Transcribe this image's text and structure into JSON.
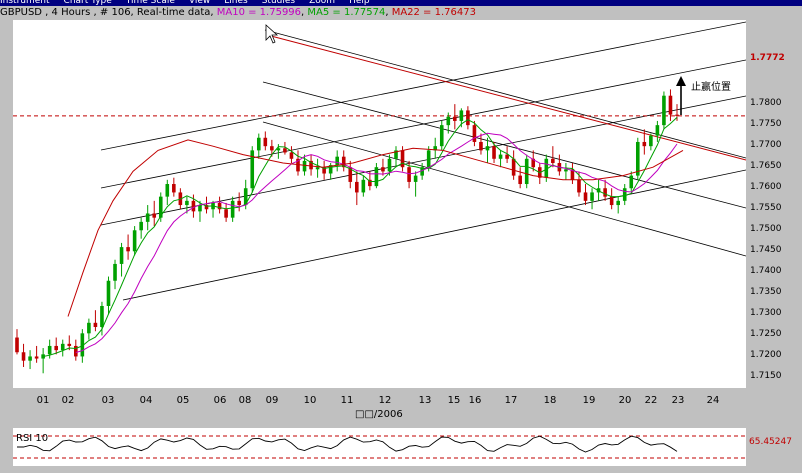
{
  "menu": [
    "Instrument",
    "Chart Type",
    "Time Scale",
    "View",
    "Lines",
    "Studies",
    "Zoom",
    "Help"
  ],
  "header": {
    "title": "GBPUSD , 4 Hours , # 106, Real-time data",
    "ma10": "MA10 = 1.75996",
    "ma5": "MA5 = 1.77574",
    "ma22": "MA22 = 1.76473"
  },
  "colors": {
    "up": "#00a000",
    "down": "#c00000",
    "ma5": "#00a000",
    "ma10": "#c000c0",
    "ma22": "#c00000",
    "ref": "#c00000"
  },
  "chart_data": {
    "type": "candlestick",
    "xlabel": "□□/2006",
    "ylim": [
      1.7125,
      1.8
    ],
    "yticks": [
      "1.7150",
      "1.7200",
      "1.7250",
      "1.7300",
      "1.7350",
      "1.7400",
      "1.7450",
      "1.7500",
      "1.7550",
      "1.7600",
      "1.7650",
      "1.7700",
      "1.7750",
      "1.7800"
    ],
    "xticks": [
      "01",
      "02",
      "03",
      "04",
      "05",
      "06",
      "08",
      "09",
      "10",
      "11",
      "12",
      "13",
      "15",
      "16",
      "17",
      "18",
      "19",
      "20",
      "22",
      "23",
      "24"
    ],
    "current_price": "1.7772",
    "annotation": "止赢位置",
    "candles": [
      [
        1.7245,
        1.7265,
        1.7205,
        1.721
      ],
      [
        1.721,
        1.723,
        1.7175,
        1.719
      ],
      [
        1.719,
        1.7215,
        1.717,
        1.72
      ],
      [
        1.72,
        1.7225,
        1.7185,
        1.7195
      ],
      [
        1.7195,
        1.722,
        1.716,
        1.7205
      ],
      [
        1.7205,
        1.724,
        1.7195,
        1.7225
      ],
      [
        1.7225,
        1.7245,
        1.7205,
        1.7215
      ],
      [
        1.7215,
        1.724,
        1.72,
        1.723
      ],
      [
        1.723,
        1.725,
        1.7215,
        1.7225
      ],
      [
        1.7225,
        1.724,
        1.719,
        1.72
      ],
      [
        1.72,
        1.7265,
        1.7185,
        1.7255
      ],
      [
        1.7255,
        1.729,
        1.724,
        1.728
      ],
      [
        1.728,
        1.731,
        1.726,
        1.727
      ],
      [
        1.727,
        1.733,
        1.725,
        1.732
      ],
      [
        1.732,
        1.739,
        1.73,
        1.738
      ],
      [
        1.738,
        1.743,
        1.736,
        1.742
      ],
      [
        1.742,
        1.747,
        1.739,
        1.746
      ],
      [
        1.746,
        1.749,
        1.743,
        1.745
      ],
      [
        1.745,
        1.751,
        1.744,
        1.75
      ],
      [
        1.75,
        1.753,
        1.748,
        1.752
      ],
      [
        1.752,
        1.756,
        1.75,
        1.754
      ],
      [
        1.754,
        1.757,
        1.751,
        1.753
      ],
      [
        1.753,
        1.759,
        1.752,
        1.758
      ],
      [
        1.758,
        1.762,
        1.756,
        1.761
      ],
      [
        1.761,
        1.7625,
        1.758,
        1.759
      ],
      [
        1.759,
        1.76,
        1.755,
        1.756
      ],
      [
        1.756,
        1.758,
        1.754,
        1.757
      ],
      [
        1.757,
        1.7585,
        1.753,
        1.7545
      ],
      [
        1.7545,
        1.757,
        1.752,
        1.756
      ],
      [
        1.756,
        1.758,
        1.754,
        1.755
      ],
      [
        1.755,
        1.757,
        1.753,
        1.7565
      ],
      [
        1.7565,
        1.758,
        1.754,
        1.755
      ],
      [
        1.755,
        1.7565,
        1.752,
        1.753
      ],
      [
        1.753,
        1.758,
        1.752,
        1.757
      ],
      [
        1.757,
        1.759,
        1.7545,
        1.756
      ],
      [
        1.756,
        1.762,
        1.755,
        1.76
      ],
      [
        1.76,
        1.77,
        1.759,
        1.769
      ],
      [
        1.769,
        1.773,
        1.767,
        1.772
      ],
      [
        1.772,
        1.7735,
        1.769,
        1.77
      ],
      [
        1.77,
        1.7715,
        1.7675,
        1.769
      ],
      [
        1.769,
        1.7705,
        1.767,
        1.7695
      ],
      [
        1.7695,
        1.771,
        1.768,
        1.7685
      ],
      [
        1.7685,
        1.77,
        1.766,
        1.767
      ],
      [
        1.767,
        1.769,
        1.763,
        1.764
      ],
      [
        1.764,
        1.768,
        1.763,
        1.7665
      ],
      [
        1.7665,
        1.768,
        1.763,
        1.7645
      ],
      [
        1.7645,
        1.767,
        1.7625,
        1.765
      ],
      [
        1.765,
        1.7665,
        1.762,
        1.7635
      ],
      [
        1.7635,
        1.766,
        1.762,
        1.7655
      ],
      [
        1.7655,
        1.769,
        1.764,
        1.7675
      ],
      [
        1.7675,
        1.769,
        1.764,
        1.765
      ],
      [
        1.765,
        1.7665,
        1.76,
        1.7615
      ],
      [
        1.7615,
        1.764,
        1.756,
        1.759
      ],
      [
        1.759,
        1.763,
        1.758,
        1.762
      ],
      [
        1.762,
        1.764,
        1.7595,
        1.7605
      ],
      [
        1.7605,
        1.766,
        1.76,
        1.765
      ],
      [
        1.765,
        1.767,
        1.763,
        1.764
      ],
      [
        1.764,
        1.768,
        1.763,
        1.767
      ],
      [
        1.767,
        1.77,
        1.765,
        1.769
      ],
      [
        1.769,
        1.77,
        1.764,
        1.765
      ],
      [
        1.765,
        1.7665,
        1.76,
        1.7615
      ],
      [
        1.7615,
        1.764,
        1.758,
        1.763
      ],
      [
        1.763,
        1.766,
        1.762,
        1.765
      ],
      [
        1.765,
        1.77,
        1.764,
        1.769
      ],
      [
        1.769,
        1.772,
        1.767,
        1.77
      ],
      [
        1.77,
        1.776,
        1.769,
        1.775
      ],
      [
        1.775,
        1.778,
        1.773,
        1.777
      ],
      [
        1.777,
        1.78,
        1.774,
        1.776
      ],
      [
        1.776,
        1.779,
        1.7745,
        1.7785
      ],
      [
        1.7785,
        1.7795,
        1.774,
        1.775
      ],
      [
        1.775,
        1.776,
        1.77,
        1.771
      ],
      [
        1.771,
        1.773,
        1.768,
        1.769
      ],
      [
        1.769,
        1.772,
        1.766,
        1.77
      ],
      [
        1.77,
        1.771,
        1.766,
        1.767
      ],
      [
        1.767,
        1.769,
        1.765,
        1.768
      ],
      [
        1.768,
        1.77,
        1.766,
        1.767
      ],
      [
        1.767,
        1.769,
        1.762,
        1.763
      ],
      [
        1.763,
        1.765,
        1.76,
        1.761
      ],
      [
        1.761,
        1.768,
        1.76,
        1.767
      ],
      [
        1.767,
        1.769,
        1.764,
        1.765
      ],
      [
        1.765,
        1.766,
        1.761,
        1.7625
      ],
      [
        1.7625,
        1.768,
        1.7615,
        1.767
      ],
      [
        1.767,
        1.77,
        1.765,
        1.766
      ],
      [
        1.766,
        1.768,
        1.763,
        1.764
      ],
      [
        1.764,
        1.766,
        1.762,
        1.7645
      ],
      [
        1.7645,
        1.766,
        1.761,
        1.762
      ],
      [
        1.762,
        1.764,
        1.758,
        1.759
      ],
      [
        1.759,
        1.761,
        1.756,
        1.757
      ],
      [
        1.757,
        1.76,
        1.755,
        1.759
      ],
      [
        1.759,
        1.762,
        1.757,
        1.76
      ],
      [
        1.76,
        1.762,
        1.757,
        1.758
      ],
      [
        1.758,
        1.76,
        1.755,
        1.756
      ],
      [
        1.756,
        1.758,
        1.754,
        1.757
      ],
      [
        1.757,
        1.761,
        1.756,
        1.76
      ],
      [
        1.76,
        1.764,
        1.759,
        1.763
      ],
      [
        1.763,
        1.772,
        1.762,
        1.771
      ],
      [
        1.771,
        1.774,
        1.768,
        1.77
      ],
      [
        1.77,
        1.773,
        1.769,
        1.7725
      ],
      [
        1.7725,
        1.776,
        1.771,
        1.775
      ],
      [
        1.775,
        1.783,
        1.774,
        1.782
      ],
      [
        1.782,
        1.7835,
        1.776,
        1.7775
      ],
      [
        1.7775,
        1.78,
        1.776,
        1.7772
      ]
    ],
    "ma22_line": [
      [
        1.7295,
        55
      ],
      [
        1.74,
        70
      ],
      [
        1.75,
        85
      ],
      [
        1.757,
        100
      ],
      [
        1.764,
        120
      ],
      [
        1.769,
        145
      ],
      [
        1.7715,
        175
      ],
      [
        1.77,
        200
      ],
      [
        1.768,
        230
      ],
      [
        1.766,
        270
      ],
      [
        1.765,
        310
      ],
      [
        1.766,
        340
      ],
      [
        1.768,
        370
      ],
      [
        1.7695,
        400
      ],
      [
        1.769,
        430
      ],
      [
        1.767,
        460
      ],
      [
        1.765,
        490
      ],
      [
        1.763,
        520
      ],
      [
        1.762,
        550
      ],
      [
        1.762,
        580
      ],
      [
        1.763,
        610
      ],
      [
        1.765,
        640
      ],
      [
        1.769,
        670
      ]
    ],
    "rsi": {
      "label": "RSI 10",
      "ref_value": "65.45247"
    }
  }
}
